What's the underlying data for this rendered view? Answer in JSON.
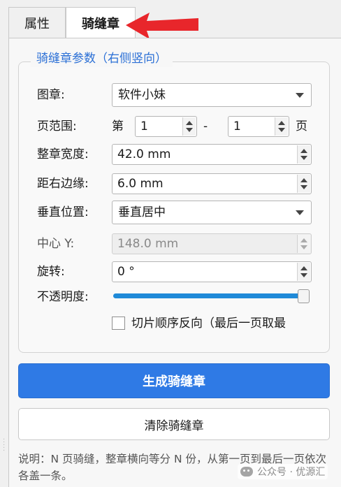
{
  "tabs": [
    {
      "label": "属性",
      "active": false
    },
    {
      "label": "骑缝章",
      "active": true
    }
  ],
  "group": {
    "title": "骑缝章参数（右侧竖向）"
  },
  "fields": {
    "stamp": {
      "label": "图章:",
      "value": "软件小妹"
    },
    "page_range": {
      "label": "页范围:",
      "prefix": "第",
      "from": "1",
      "dash": "-",
      "to": "1",
      "suffix": "页"
    },
    "width": {
      "label": "整章宽度:",
      "value": "42.0 mm"
    },
    "right_margin": {
      "label": "距右边缘:",
      "value": "6.0 mm"
    },
    "vertical_position": {
      "label": "垂直位置:",
      "value": "垂直居中"
    },
    "center_y": {
      "label": "中心 Y:",
      "value": "148.0 mm",
      "disabled": true
    },
    "rotation": {
      "label": "旋转:",
      "value": "0 °"
    },
    "opacity": {
      "label": "不透明度:",
      "fraction": 1.0
    }
  },
  "reverse_slices": {
    "label": "切片顺序反向（最后一页取最",
    "checked": false
  },
  "buttons": {
    "generate": "生成骑缝章",
    "clear": "清除骑缝章"
  },
  "note": "说明：N 页骑缝，整章横向等分 N 份，从第一页到最后一页依次各盖一条。",
  "watermark": "公众号 · 优源汇",
  "colors": {
    "accent": "#2f7ae5",
    "group_title": "#2a6fd6",
    "arrow": "#e8262b",
    "slider": "#1f8ad8"
  }
}
